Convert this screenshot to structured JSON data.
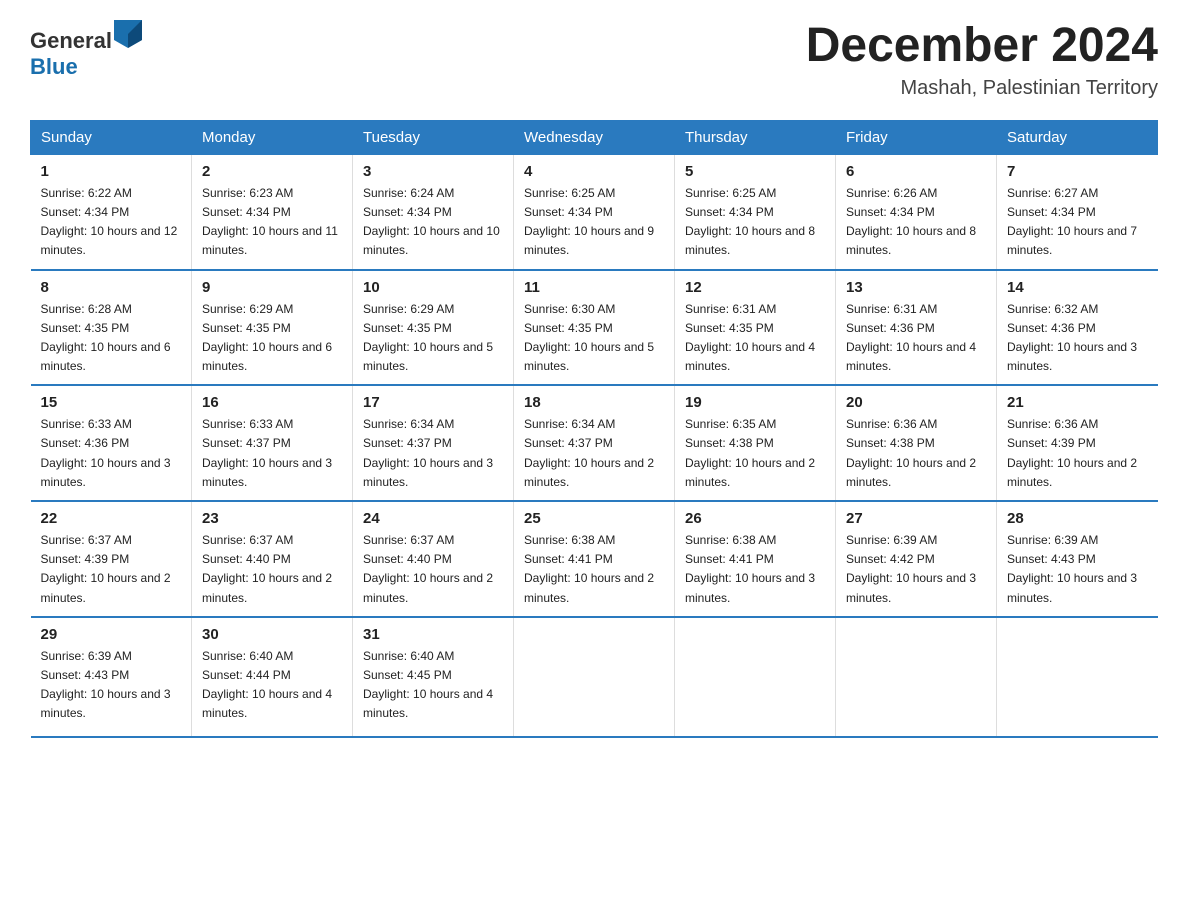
{
  "logo": {
    "text_general": "General",
    "text_blue": "Blue"
  },
  "title": "December 2024",
  "location": "Mashah, Palestinian Territory",
  "days_of_week": [
    "Sunday",
    "Monday",
    "Tuesday",
    "Wednesday",
    "Thursday",
    "Friday",
    "Saturday"
  ],
  "weeks": [
    [
      {
        "day": "1",
        "sunrise": "Sunrise: 6:22 AM",
        "sunset": "Sunset: 4:34 PM",
        "daylight": "Daylight: 10 hours and 12 minutes."
      },
      {
        "day": "2",
        "sunrise": "Sunrise: 6:23 AM",
        "sunset": "Sunset: 4:34 PM",
        "daylight": "Daylight: 10 hours and 11 minutes."
      },
      {
        "day": "3",
        "sunrise": "Sunrise: 6:24 AM",
        "sunset": "Sunset: 4:34 PM",
        "daylight": "Daylight: 10 hours and 10 minutes."
      },
      {
        "day": "4",
        "sunrise": "Sunrise: 6:25 AM",
        "sunset": "Sunset: 4:34 PM",
        "daylight": "Daylight: 10 hours and 9 minutes."
      },
      {
        "day": "5",
        "sunrise": "Sunrise: 6:25 AM",
        "sunset": "Sunset: 4:34 PM",
        "daylight": "Daylight: 10 hours and 8 minutes."
      },
      {
        "day": "6",
        "sunrise": "Sunrise: 6:26 AM",
        "sunset": "Sunset: 4:34 PM",
        "daylight": "Daylight: 10 hours and 8 minutes."
      },
      {
        "day": "7",
        "sunrise": "Sunrise: 6:27 AM",
        "sunset": "Sunset: 4:34 PM",
        "daylight": "Daylight: 10 hours and 7 minutes."
      }
    ],
    [
      {
        "day": "8",
        "sunrise": "Sunrise: 6:28 AM",
        "sunset": "Sunset: 4:35 PM",
        "daylight": "Daylight: 10 hours and 6 minutes."
      },
      {
        "day": "9",
        "sunrise": "Sunrise: 6:29 AM",
        "sunset": "Sunset: 4:35 PM",
        "daylight": "Daylight: 10 hours and 6 minutes."
      },
      {
        "day": "10",
        "sunrise": "Sunrise: 6:29 AM",
        "sunset": "Sunset: 4:35 PM",
        "daylight": "Daylight: 10 hours and 5 minutes."
      },
      {
        "day": "11",
        "sunrise": "Sunrise: 6:30 AM",
        "sunset": "Sunset: 4:35 PM",
        "daylight": "Daylight: 10 hours and 5 minutes."
      },
      {
        "day": "12",
        "sunrise": "Sunrise: 6:31 AM",
        "sunset": "Sunset: 4:35 PM",
        "daylight": "Daylight: 10 hours and 4 minutes."
      },
      {
        "day": "13",
        "sunrise": "Sunrise: 6:31 AM",
        "sunset": "Sunset: 4:36 PM",
        "daylight": "Daylight: 10 hours and 4 minutes."
      },
      {
        "day": "14",
        "sunrise": "Sunrise: 6:32 AM",
        "sunset": "Sunset: 4:36 PM",
        "daylight": "Daylight: 10 hours and 3 minutes."
      }
    ],
    [
      {
        "day": "15",
        "sunrise": "Sunrise: 6:33 AM",
        "sunset": "Sunset: 4:36 PM",
        "daylight": "Daylight: 10 hours and 3 minutes."
      },
      {
        "day": "16",
        "sunrise": "Sunrise: 6:33 AM",
        "sunset": "Sunset: 4:37 PM",
        "daylight": "Daylight: 10 hours and 3 minutes."
      },
      {
        "day": "17",
        "sunrise": "Sunrise: 6:34 AM",
        "sunset": "Sunset: 4:37 PM",
        "daylight": "Daylight: 10 hours and 3 minutes."
      },
      {
        "day": "18",
        "sunrise": "Sunrise: 6:34 AM",
        "sunset": "Sunset: 4:37 PM",
        "daylight": "Daylight: 10 hours and 2 minutes."
      },
      {
        "day": "19",
        "sunrise": "Sunrise: 6:35 AM",
        "sunset": "Sunset: 4:38 PM",
        "daylight": "Daylight: 10 hours and 2 minutes."
      },
      {
        "day": "20",
        "sunrise": "Sunrise: 6:36 AM",
        "sunset": "Sunset: 4:38 PM",
        "daylight": "Daylight: 10 hours and 2 minutes."
      },
      {
        "day": "21",
        "sunrise": "Sunrise: 6:36 AM",
        "sunset": "Sunset: 4:39 PM",
        "daylight": "Daylight: 10 hours and 2 minutes."
      }
    ],
    [
      {
        "day": "22",
        "sunrise": "Sunrise: 6:37 AM",
        "sunset": "Sunset: 4:39 PM",
        "daylight": "Daylight: 10 hours and 2 minutes."
      },
      {
        "day": "23",
        "sunrise": "Sunrise: 6:37 AM",
        "sunset": "Sunset: 4:40 PM",
        "daylight": "Daylight: 10 hours and 2 minutes."
      },
      {
        "day": "24",
        "sunrise": "Sunrise: 6:37 AM",
        "sunset": "Sunset: 4:40 PM",
        "daylight": "Daylight: 10 hours and 2 minutes."
      },
      {
        "day": "25",
        "sunrise": "Sunrise: 6:38 AM",
        "sunset": "Sunset: 4:41 PM",
        "daylight": "Daylight: 10 hours and 2 minutes."
      },
      {
        "day": "26",
        "sunrise": "Sunrise: 6:38 AM",
        "sunset": "Sunset: 4:41 PM",
        "daylight": "Daylight: 10 hours and 3 minutes."
      },
      {
        "day": "27",
        "sunrise": "Sunrise: 6:39 AM",
        "sunset": "Sunset: 4:42 PM",
        "daylight": "Daylight: 10 hours and 3 minutes."
      },
      {
        "day": "28",
        "sunrise": "Sunrise: 6:39 AM",
        "sunset": "Sunset: 4:43 PM",
        "daylight": "Daylight: 10 hours and 3 minutes."
      }
    ],
    [
      {
        "day": "29",
        "sunrise": "Sunrise: 6:39 AM",
        "sunset": "Sunset: 4:43 PM",
        "daylight": "Daylight: 10 hours and 3 minutes."
      },
      {
        "day": "30",
        "sunrise": "Sunrise: 6:40 AM",
        "sunset": "Sunset: 4:44 PM",
        "daylight": "Daylight: 10 hours and 4 minutes."
      },
      {
        "day": "31",
        "sunrise": "Sunrise: 6:40 AM",
        "sunset": "Sunset: 4:45 PM",
        "daylight": "Daylight: 10 hours and 4 minutes."
      },
      {
        "day": "",
        "sunrise": "",
        "sunset": "",
        "daylight": ""
      },
      {
        "day": "",
        "sunrise": "",
        "sunset": "",
        "daylight": ""
      },
      {
        "day": "",
        "sunrise": "",
        "sunset": "",
        "daylight": ""
      },
      {
        "day": "",
        "sunrise": "",
        "sunset": "",
        "daylight": ""
      }
    ]
  ]
}
